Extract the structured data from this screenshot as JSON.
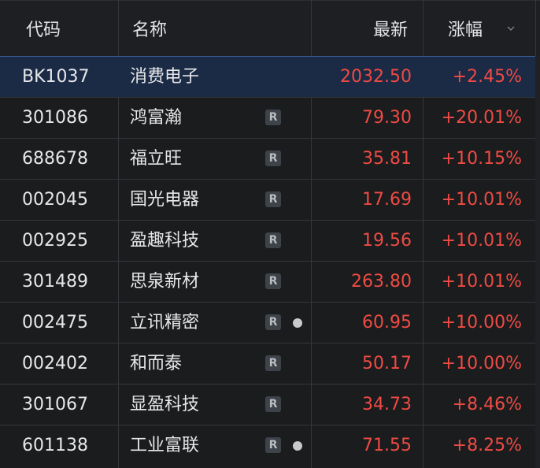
{
  "header": {
    "code": "代码",
    "name": "名称",
    "latest": "最新",
    "change": "涨幅"
  },
  "colors": {
    "up": "#ee4b44",
    "text": "#e6e7e9",
    "background": "#1b1c1e",
    "selected_row": "#1b2a45"
  },
  "rows": [
    {
      "code": "BK1037",
      "name": "消费电子",
      "badge": "",
      "dot": false,
      "price": "2032.50",
      "change": "+2.45%",
      "selected": true
    },
    {
      "code": "301086",
      "name": "鸿富瀚",
      "badge": "R",
      "dot": false,
      "price": "79.30",
      "change": "+20.01%",
      "selected": false
    },
    {
      "code": "688678",
      "name": "福立旺",
      "badge": "R",
      "dot": false,
      "price": "35.81",
      "change": "+10.15%",
      "selected": false
    },
    {
      "code": "002045",
      "name": "国光电器",
      "badge": "R",
      "dot": false,
      "price": "17.69",
      "change": "+10.01%",
      "selected": false
    },
    {
      "code": "002925",
      "name": "盈趣科技",
      "badge": "R",
      "dot": false,
      "price": "19.56",
      "change": "+10.01%",
      "selected": false
    },
    {
      "code": "301489",
      "name": "思泉新材",
      "badge": "R",
      "dot": false,
      "price": "263.80",
      "change": "+10.01%",
      "selected": false
    },
    {
      "code": "002475",
      "name": "立讯精密",
      "badge": "R",
      "dot": true,
      "price": "60.95",
      "change": "+10.00%",
      "selected": false
    },
    {
      "code": "002402",
      "name": "和而泰",
      "badge": "R",
      "dot": false,
      "price": "50.17",
      "change": "+10.00%",
      "selected": false
    },
    {
      "code": "301067",
      "name": "显盈科技",
      "badge": "R",
      "dot": false,
      "price": "34.73",
      "change": "+8.46%",
      "selected": false
    },
    {
      "code": "601138",
      "name": "工业富联",
      "badge": "R",
      "dot": true,
      "price": "71.55",
      "change": "+8.25%",
      "selected": false
    }
  ]
}
